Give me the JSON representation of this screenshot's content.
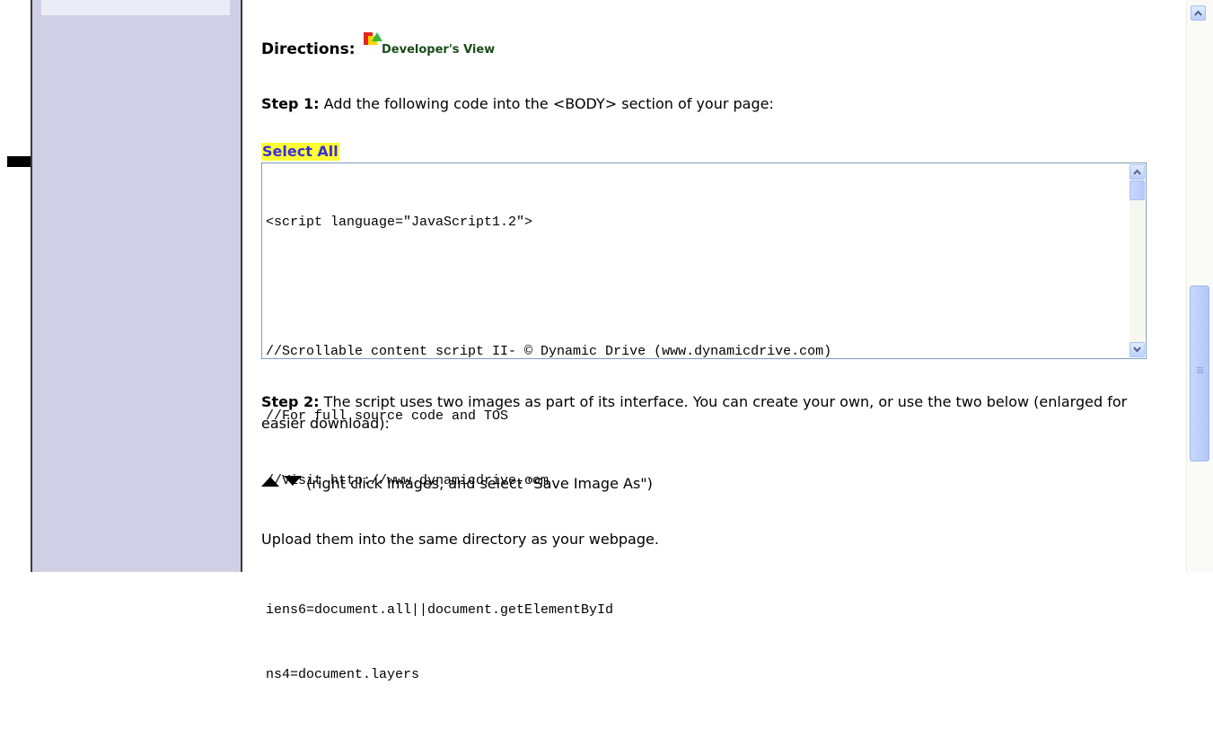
{
  "directions": {
    "label": "Directions:",
    "view_label": "Developer's View"
  },
  "step1": {
    "label": "Step 1:",
    "text": " Add the following code into the <BODY> section of your page:"
  },
  "select_all": "Select All",
  "code_lines": [
    "<script language=\"JavaScript1.2\">",
    "",
    "//Scrollable content script II- © Dynamic Drive (www.dynamicdrive.com)",
    "//For full source code and TOS",
    "//Visit http://www.dynamicdrive.com",
    "",
    "iens6=document.all||document.getElementById",
    "ns4=document.layers"
  ],
  "step2": {
    "label": "Step 2:",
    "text": " The script uses two images as part of its interface. You can create your own, or use the two below (enlarged for easier download):"
  },
  "images_note": " (right click images, and select \"Save Image As\")",
  "upload_note": "Upload them into the same directory as your webpage.",
  "icons": [
    "right-arrow-icon",
    "developer-view-icon",
    "up-arrow-icon",
    "down-arrow-icon",
    "scroll-up-icon",
    "scroll-down-icon"
  ],
  "colors": {
    "sidebar": "#cfcfe6",
    "select_all_bg": "#ffff33",
    "select_all_text": "#3a2fd4",
    "textarea_border": "#7f9db9"
  }
}
